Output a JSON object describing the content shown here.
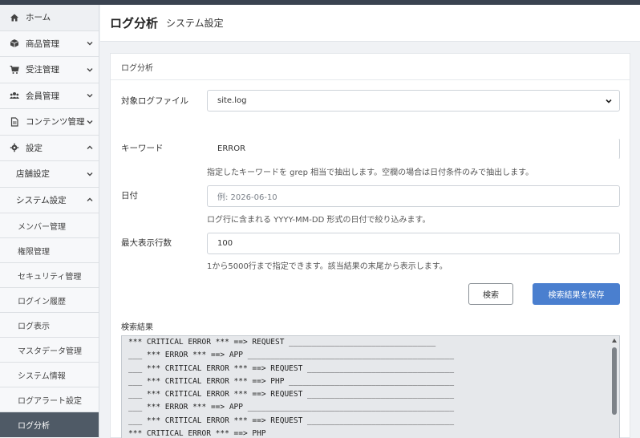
{
  "sidebar": {
    "items": [
      {
        "label": "ホーム",
        "icon": "home-icon"
      },
      {
        "label": "商品管理",
        "icon": "box-icon"
      },
      {
        "label": "受注管理",
        "icon": "cart-icon"
      },
      {
        "label": "会員管理",
        "icon": "users-icon"
      },
      {
        "label": "コンテンツ管理",
        "icon": "document-icon"
      },
      {
        "label": "設定",
        "icon": "gear-icon"
      }
    ],
    "settings_sub": [
      {
        "label": "店舗設定"
      },
      {
        "label": "システム設定"
      }
    ],
    "system_sub": [
      {
        "label": "メンバー管理"
      },
      {
        "label": "権限管理"
      },
      {
        "label": "セキュリティ管理"
      },
      {
        "label": "ログイン履歴"
      },
      {
        "label": "ログ表示"
      },
      {
        "label": "マスタデータ管理"
      },
      {
        "label": "システム情報"
      },
      {
        "label": "ログアラート設定"
      },
      {
        "label": "ログ分析"
      }
    ]
  },
  "header": {
    "title": "ログ分析",
    "subtitle": "システム設定"
  },
  "card": {
    "title": "ログ分析"
  },
  "form": {
    "file_label": "対象ログファイル",
    "file_value": "site.log",
    "keyword_label": "キーワード",
    "keyword_value": "ERROR",
    "keyword_help": "指定したキーワードを grep 相当で抽出します。空欄の場合は日付条件のみで抽出します。",
    "date_label": "日付",
    "date_placeholder": "例: 2026-06-10",
    "date_help": "ログ行に含まれる YYYY-MM-DD 形式の日付で絞り込みます。",
    "max_rows_label": "最大表示行数",
    "max_rows_value": "100",
    "max_rows_help": "1から5000行まで指定できます。該当結果の末尾から表示します。",
    "search_button": "検索",
    "save_button": "検索結果を保存"
  },
  "results": {
    "label": "検索結果",
    "lines": [
      "    *** CRITICAL ERROR *** ==> REQUEST ________________________________",
      "___ *** ERROR *** ==> APP _____________________________________________",
      "___ *** CRITICAL ERROR *** ==> REQUEST ________________________________",
      "___ *** CRITICAL ERROR *** ==> PHP ____________________________________",
      "___ *** CRITICAL ERROR *** ==> REQUEST ________________________________",
      "___ *** ERROR *** ==> APP _____________________________________________",
      "___ *** CRITICAL ERROR *** ==> REQUEST ________________________________",
      "    *** CRITICAL ERROR *** ==> PHP"
    ]
  }
}
